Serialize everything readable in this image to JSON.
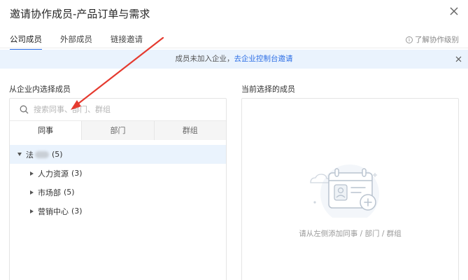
{
  "dialog": {
    "title": "邀请协作成员-产品订单与需求"
  },
  "tabs": [
    {
      "label": "公司成员"
    },
    {
      "label": "外部成员"
    },
    {
      "label": "链接邀请"
    }
  ],
  "help": {
    "label": "了解协作级别"
  },
  "notice": {
    "text": "成员未加入企业，",
    "link": "去企业控制台邀请"
  },
  "left": {
    "title": "从企业内选择成员",
    "search_placeholder": "搜索同事、部门、群组",
    "subtabs": [
      {
        "label": "同事"
      },
      {
        "label": "部门"
      },
      {
        "label": "群组"
      }
    ],
    "tree": {
      "root": {
        "label": "法",
        "count": "(5)"
      },
      "children": [
        {
          "label": "人力资源",
          "count": "(3)"
        },
        {
          "label": "市场部",
          "count": "(5)"
        },
        {
          "label": "营销中心",
          "count": "(3)"
        }
      ]
    }
  },
  "right": {
    "title": "当前选择的成员",
    "empty_text": "请从左侧添加同事 / 部门 / 群组"
  },
  "colors": {
    "accent": "#2b6de5",
    "notice_bg": "#eaf3fd",
    "annotation_arrow": "#e53a2f"
  }
}
